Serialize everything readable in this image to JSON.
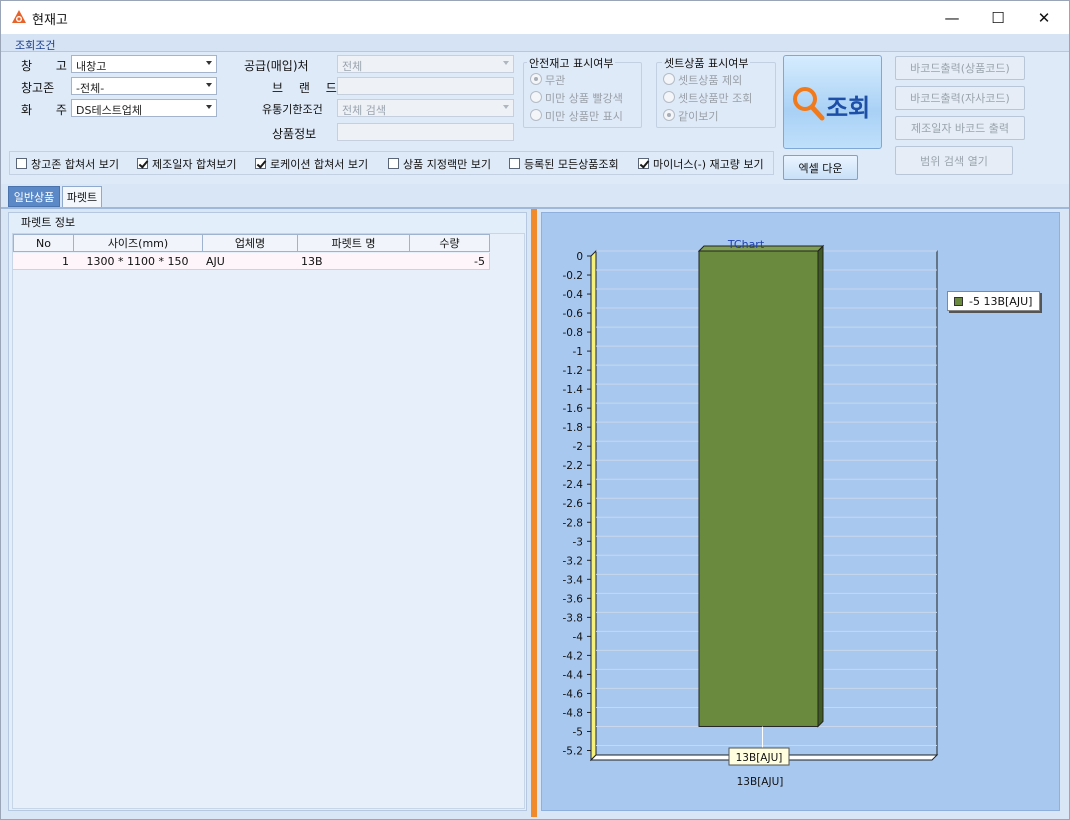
{
  "window": {
    "title": "현재고",
    "minimize": "—",
    "maximize": "☐",
    "close": "✕"
  },
  "conditions": {
    "header": "조회조건",
    "warehouse_label": "창 고",
    "warehouse_value": "내창고",
    "zone_label": "창고존",
    "zone_value": "-전체-",
    "owner_label": "화 주",
    "owner_value": "DS테스트업체",
    "supplier_label": "공급(매입)처",
    "supplier_value": "전체",
    "brand_label": "브 랜 드",
    "expiry_label": "유통기한조건",
    "expiry_value": "전체 검색",
    "product_label": "상품정보"
  },
  "safety_stock": {
    "title": "안전재고 표시여부",
    "options": [
      "무관",
      "미만 상품 빨강색",
      "미만 상품만 표시"
    ],
    "selected": 0
  },
  "set_product": {
    "title": "셋트상품 표시여부",
    "options": [
      "셋트상품 제외",
      "셋트상품만 조회",
      "같이보기"
    ],
    "selected": 2
  },
  "buttons": {
    "search": "조회",
    "excel": "엑셀 다운",
    "barcode_product": "바코드출력(상품코드)",
    "barcode_own": "바코드출력(자사코드)",
    "barcode_mfg": "제조일자 바코드 출력",
    "range_search": "범위 검색 열기"
  },
  "checkboxes": [
    {
      "label": "창고존 합쳐서 보기",
      "checked": false
    },
    {
      "label": "제조일자 합쳐보기",
      "checked": true
    },
    {
      "label": "로케이션 합쳐서 보기",
      "checked": true
    },
    {
      "label": "상품 지정랙만 보기",
      "checked": false
    },
    {
      "label": "등록된 모든상품조회",
      "checked": false
    },
    {
      "label": "마이너스(-) 재고량 보기",
      "checked": true
    }
  ],
  "tabs": {
    "general": "일반상품",
    "pallet": "파렛트"
  },
  "pallet_panel": {
    "title": "파렛트 정보",
    "columns": [
      "No",
      "사이즈(mm)",
      "업체명",
      "파렛트 명",
      "수량"
    ],
    "rows": [
      [
        "1",
        "1300 * 1100 * 150",
        "AJU",
        "13B",
        "-5"
      ]
    ]
  },
  "chart_data": {
    "type": "bar",
    "title": "TChart",
    "categories": [
      "13B[AJU]"
    ],
    "series": [
      {
        "name": "-5 13B[AJU]",
        "values": [
          -5
        ],
        "color": "#6a8a3e"
      }
    ],
    "ylim": [
      -5.3,
      0
    ],
    "yticks": [
      0,
      -0.2,
      -0.4,
      -0.6,
      -0.8,
      -1,
      -1.2,
      -1.4,
      -1.6,
      -1.8,
      -2,
      -2.2,
      -2.4,
      -2.6,
      -2.8,
      -3,
      -3.2,
      -3.4,
      -3.6,
      -3.8,
      -4,
      -4.2,
      -4.4,
      -4.6,
      -4.8,
      -5,
      -5.2
    ],
    "data_label": "13B[AJU]",
    "legend": "right",
    "grid": true
  }
}
